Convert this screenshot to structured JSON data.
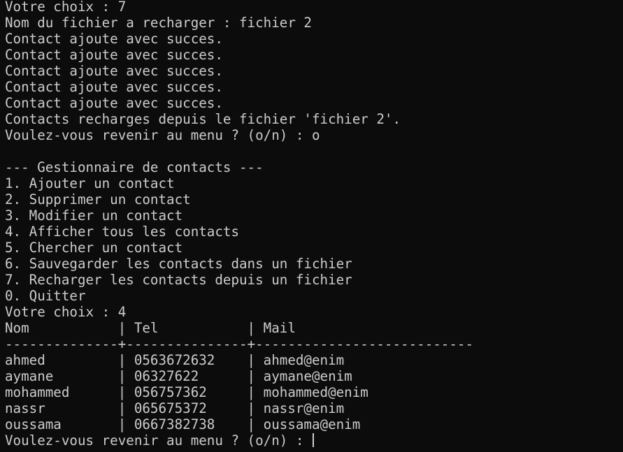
{
  "terminal": {
    "bg_color": "#0c0c0c",
    "fg_color": "#cccccc",
    "lines": [
      "Votre choix : 7",
      "Nom du fichier a recharger : fichier 2",
      "Contact ajoute avec succes.",
      "Contact ajoute avec succes.",
      "Contact ajoute avec succes.",
      "Contact ajoute avec succes.",
      "Contact ajoute avec succes.",
      "Contacts recharges depuis le fichier 'fichier 2'.",
      "Voulez-vous revenir au menu ? (o/n) : o",
      "",
      "--- Gestionnaire de contacts ---",
      "1. Ajouter un contact",
      "2. Supprimer un contact",
      "3. Modifier un contact",
      "4. Afficher tous les contacts",
      "5. Chercher un contact",
      "6. Sauvegarder les contacts dans un fichier",
      "7. Recharger les contacts depuis un fichier",
      "0. Quitter",
      "Votre choix : 4",
      "Nom           | Tel           | Mail",
      "--------------+---------------+---------------------------",
      "ahmed         | 0563672632    | ahmed@enim",
      "aymane        | 06327622      | aymane@enim",
      "mohammed      | 056757362     | mohammed@enim",
      "nassr         | 065675372     | nassr@enim",
      "oussama       | 0667382738    | oussama@enim"
    ],
    "prompt_line": "Voulez-vous revenir au menu ? (o/n) : "
  }
}
